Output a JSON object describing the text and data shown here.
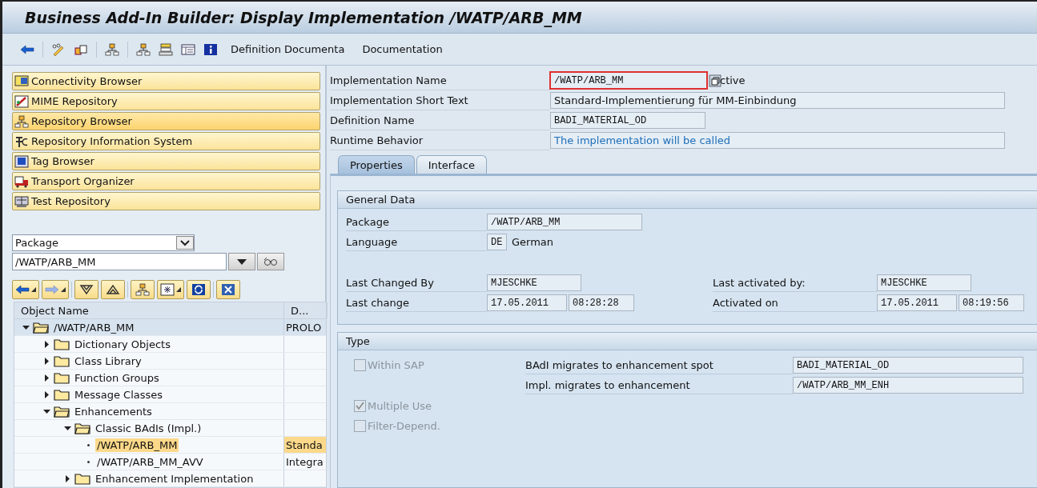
{
  "window": {
    "title": "Business Add-In Builder: Display Implementation /WATP/ARB_MM"
  },
  "toolbar": {
    "text_buttons": [
      "Definition Documenta",
      "Documentation"
    ]
  },
  "navigator": [
    {
      "label": "Connectivity Browser",
      "selected": false
    },
    {
      "label": "MIME Repository",
      "selected": false
    },
    {
      "label": "Repository Browser",
      "selected": true
    },
    {
      "label": "Repository Information System",
      "selected": false
    },
    {
      "label": "Tag Browser",
      "selected": false
    },
    {
      "label": "Transport Organizer",
      "selected": false
    },
    {
      "label": "Test Repository",
      "selected": false
    }
  ],
  "object_selector": {
    "type": "Package",
    "value": "/WATP/ARB_MM"
  },
  "tree": {
    "columns": [
      "Object Name",
      "D..."
    ],
    "rows": [
      {
        "kind": "folder",
        "name": "/WATP/ARB_MM",
        "description": "PROLO",
        "expanded": true,
        "selected": false,
        "children": [
          {
            "kind": "folder",
            "name": "Dictionary Objects",
            "expanded": false,
            "selected": false
          },
          {
            "kind": "folder",
            "name": "Class Library",
            "expanded": false,
            "selected": false
          },
          {
            "kind": "folder",
            "name": "Function Groups",
            "expanded": false,
            "selected": false
          },
          {
            "kind": "folder",
            "name": "Message Classes",
            "expanded": false,
            "selected": false
          },
          {
            "kind": "folder",
            "name": "Enhancements",
            "expanded": true,
            "selected": false,
            "children": [
              {
                "kind": "folder",
                "name": "Classic BAdIs (Impl.)",
                "expanded": true,
                "selected": false,
                "children": [
                  {
                    "kind": "object",
                    "name": "/WATP/ARB_MM",
                    "description": "Standa",
                    "selected": true
                  },
                  {
                    "kind": "object",
                    "name": "/WATP/ARB_MM_AVV",
                    "description": "Integra",
                    "selected": false
                  }
                ]
              },
              {
                "kind": "folder",
                "name": "Enhancement Implementation",
                "expanded": false,
                "selected": false
              }
            ]
          }
        ]
      }
    ]
  },
  "header": {
    "fields": [
      {
        "label": "Implementation Name",
        "value": "/WATP/ARB_MM",
        "kind": "name",
        "status": "ctive"
      },
      {
        "label": "Implementation Short Text",
        "value": "Standard-Implementierung für MM-Einbindung",
        "kind": "text"
      },
      {
        "label": "Definition Name",
        "value": "BADI_MATERIAL_OD",
        "kind": "code"
      },
      {
        "label": "Runtime Behavior",
        "value": "The implementation will be called",
        "kind": "info"
      }
    ]
  },
  "tabs": [
    {
      "label": "Properties",
      "selected": true
    },
    {
      "label": "Interface",
      "selected": false
    }
  ],
  "general_data": {
    "title": "General Data",
    "package": {
      "label": "Package",
      "value": "/WATP/ARB_MM"
    },
    "language": {
      "label": "Language",
      "code": "DE",
      "name": "German"
    },
    "last_changed_by": {
      "label": "Last Changed By",
      "value": "MJESCHKE"
    },
    "last_change": {
      "label": "Last change",
      "date": "17.05.2011",
      "time": "08:28:28"
    },
    "last_activated_by": {
      "label": "Last activated by:",
      "value": "MJESCHKE"
    },
    "activated_on": {
      "label": "Activated on",
      "date": "17.05.2011",
      "time": "08:19:56"
    }
  },
  "type_group": {
    "title": "Type",
    "checkboxes": [
      {
        "label": "Within SAP",
        "checked": false,
        "disabled": true
      },
      {
        "label": "Multiple Use",
        "checked": true,
        "disabled": true
      },
      {
        "label": "Filter-Depend.",
        "checked": false,
        "disabled": true
      }
    ],
    "migrations": [
      {
        "label": "BAdI migrates to enhancement spot",
        "value": "BADI_MATERIAL_OD"
      },
      {
        "label": "Impl. migrates to enhancement",
        "value": "/WATP/ARB_MM_ENH"
      }
    ]
  }
}
